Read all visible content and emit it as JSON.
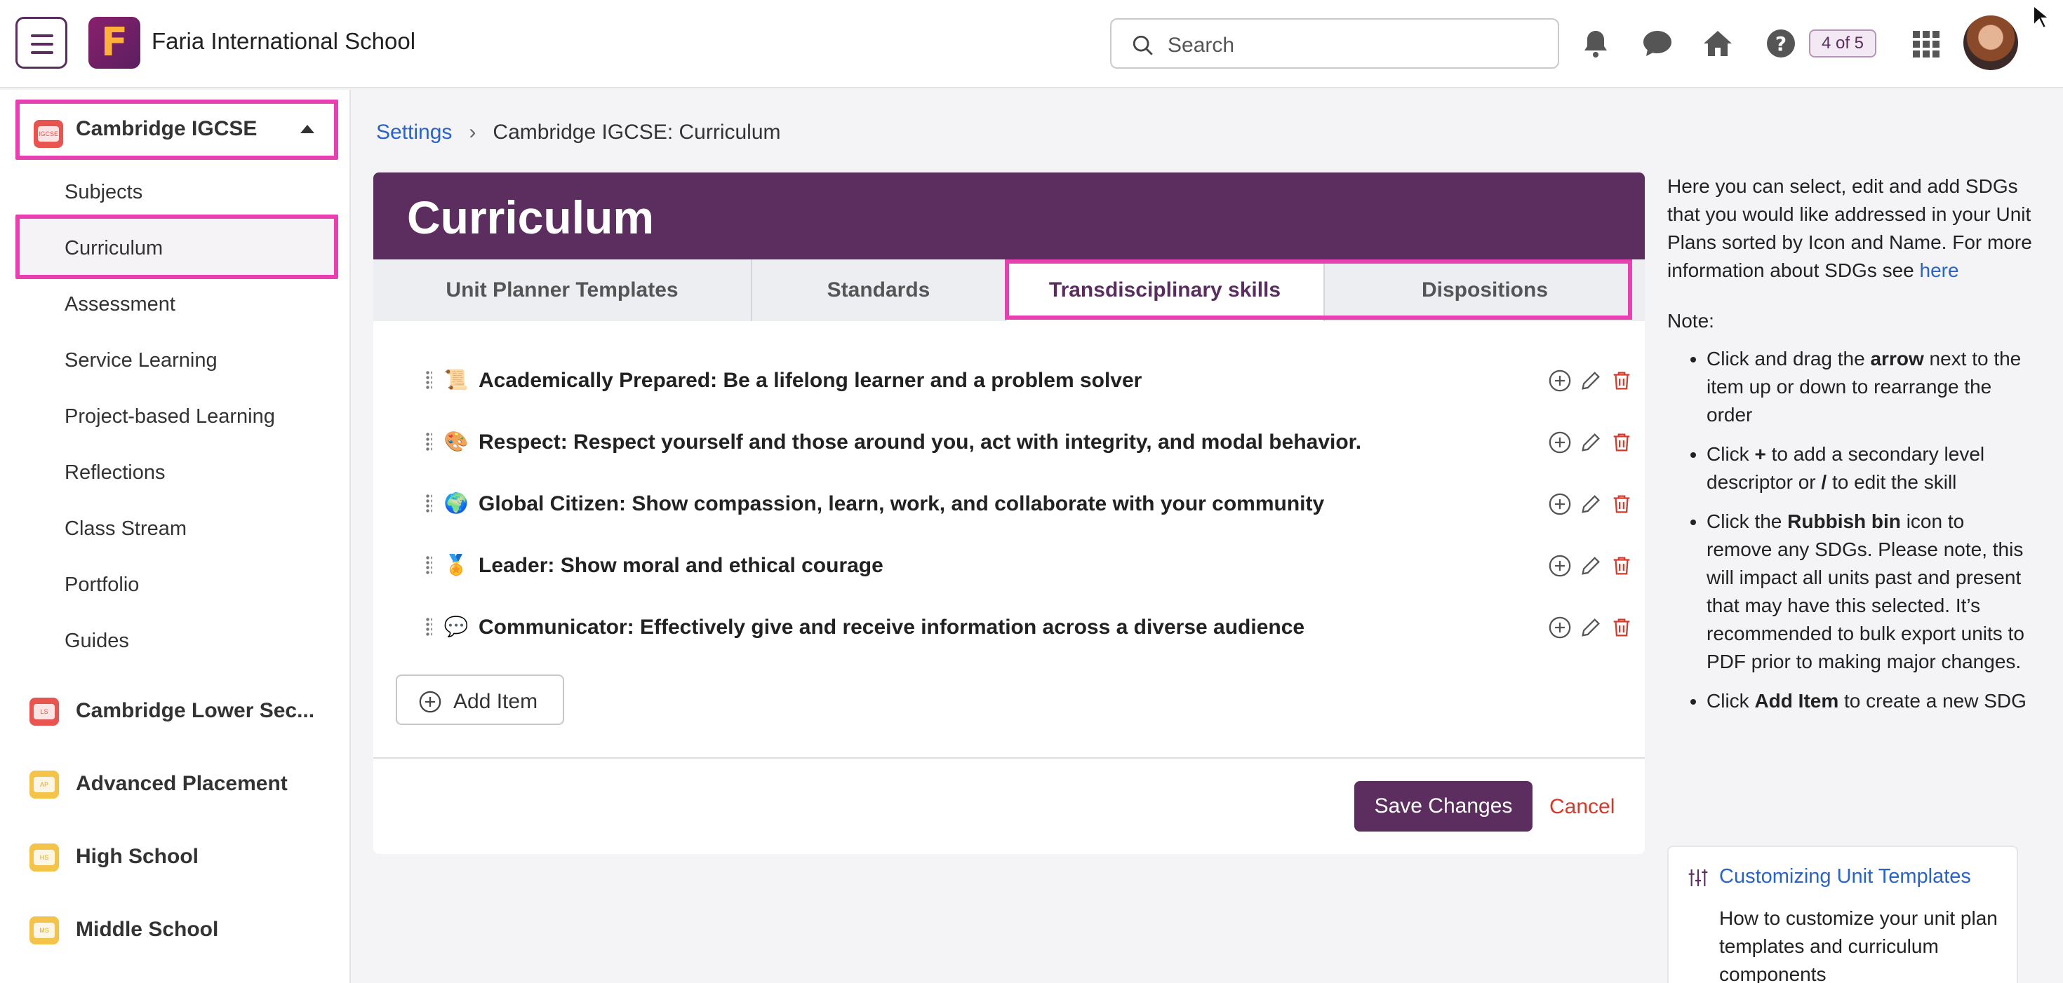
{
  "header": {
    "school_name": "Faria International School",
    "logo_letter": "F",
    "search_placeholder": "Search",
    "tour_badge": "4 of 5",
    "icons": [
      "bell-icon",
      "chat-icon",
      "home-icon",
      "help-icon",
      "apps-grid-icon"
    ]
  },
  "sidebar": {
    "active_program": {
      "label": "Cambridge IGCSE",
      "badge": "IGCSE",
      "color": "#e8544f"
    },
    "sub_items": [
      "Subjects",
      "Curriculum",
      "Assessment",
      "Service Learning",
      "Project-based Learning",
      "Reflections",
      "Class Stream",
      "Portfolio",
      "Guides"
    ],
    "active_sub_item": "Curriculum",
    "programs": [
      {
        "label": "Cambridge Lower Sec...",
        "badge": "LS",
        "color": "#e8544f"
      },
      {
        "label": "Advanced Placement",
        "badge": "AP",
        "color": "#f3c34a"
      },
      {
        "label": "High School",
        "badge": "HS",
        "color": "#f3c34a"
      },
      {
        "label": "Middle School",
        "badge": "MS",
        "color": "#f3c34a"
      }
    ]
  },
  "breadcrumb": {
    "root": "Settings",
    "current": "Cambridge IGCSE: Curriculum"
  },
  "main": {
    "title": "Curriculum",
    "tabs": [
      "Unit Planner Templates",
      "Standards",
      "Transdisciplinary skills",
      "Dispositions"
    ],
    "active_tab": "Transdisciplinary skills",
    "items": [
      {
        "icon": "book-icon",
        "emoji": "📜",
        "text": "Academically Prepared: Be a lifelong learner and a problem solver"
      },
      {
        "icon": "palette-icon",
        "emoji": "🎨",
        "text": "Respect: Respect yourself and those around you, act with integrity, and modal behavior."
      },
      {
        "icon": "globe-icon",
        "emoji": "🌍",
        "text": "Global Citizen: Show compassion, learn, work, and collaborate with your community"
      },
      {
        "icon": "medal-icon",
        "emoji": "🏅",
        "text": "Leader: Show moral and ethical courage"
      },
      {
        "icon": "speech-bubbles-icon",
        "emoji": "💬",
        "text": "Communicator: Effectively give and receive information across a diverse audience"
      }
    ],
    "add_item_label": "Add Item",
    "save_label": "Save Changes",
    "cancel_label": "Cancel"
  },
  "help": {
    "intro": "Here you can select, edit and add SDGs that you would like addressed in your Unit Plans sorted by Icon and Name. For more information about SDGs see",
    "intro_link": "here",
    "note_heading": "Note:",
    "bullets": [
      {
        "pre": "Click and drag the ",
        "bold": "arrow",
        "post": " next to the item up or down to rearrange the order"
      },
      {
        "pre": "Click ",
        "bold": "+",
        "post": " to add a secondary level descriptor or ",
        "bold2": "/",
        "post2": " to edit the skill"
      },
      {
        "pre": "Click the ",
        "bold": "Rubbish bin",
        "post": " icon to remove any SDGs. Please note, this will impact all units past and present that may have this selected. It’s recommended to bulk export units to PDF prior to making major changes."
      },
      {
        "pre": "Click ",
        "bold": "Add Item",
        "post": " to create a new SDG"
      }
    ],
    "tip_title": "Customizing Unit Templates",
    "tip_desc": "How to customize your unit plan templates and curriculum components"
  },
  "colors": {
    "brand": "#5c2d5f",
    "highlight": "#e83fb1",
    "link": "#2a63c6",
    "danger": "#d33a2c"
  }
}
